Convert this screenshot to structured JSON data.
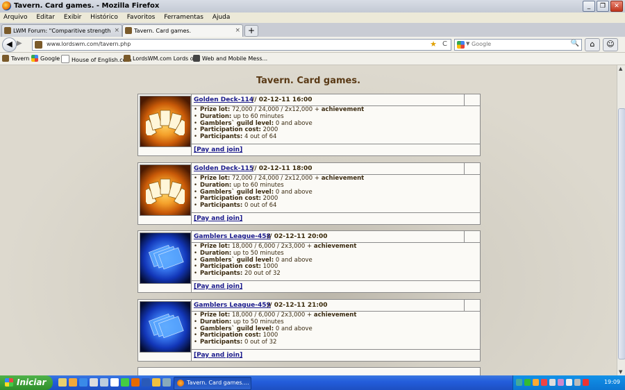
{
  "window": {
    "title": "Tavern. Card games. - Mozilla Firefox",
    "min": "_",
    "max": "❐",
    "close": "✕"
  },
  "menu": [
    "Arquivo",
    "Editar",
    "Exibir",
    "Histórico",
    "Favoritos",
    "Ferramentas",
    "Ajuda"
  ],
  "tabs": [
    {
      "label": "LWM Forum: \"Comparitive strengths\". Lo...",
      "close": "×"
    },
    {
      "label": "Tavern. Card games.",
      "close": "×"
    }
  ],
  "newtab": "+",
  "nav": {
    "back": "◀",
    "forward": "▶",
    "url": "www.lordswm.com/tavern.php",
    "search_placeholder": "Google",
    "star": "★",
    "reload": "C",
    "search_icon": "🔍",
    "home": "⌂",
    "addon": "☺"
  },
  "bookmarks": [
    "Tavern",
    "Google",
    "House of English.com",
    "LordsWM.com Lords o...",
    "Web and Mobile Mess..."
  ],
  "page": {
    "title": "Tavern. Card games.",
    "tournaments": [
      {
        "name": "Golden Deck-114",
        "date": "// 02-12-11 16:00",
        "icon": "golden-cards",
        "prize_label": "Prize lot:",
        "prize": "72,000 / 24,000 / 2x12,000 +",
        "prize_extra": "achievement",
        "duration_label": "Duration:",
        "duration": "up to 60 minutes",
        "guild_label": "Gamblers` guild level:",
        "guild": "0 and above",
        "cost_label": "Participation cost:",
        "cost": "2000",
        "participants_label": "Participants:",
        "participants": "4 out of 64",
        "join": "[Pay and join]"
      },
      {
        "name": "Golden Deck-115",
        "date": "// 02-12-11 18:00",
        "icon": "golden-cards",
        "prize_label": "Prize lot:",
        "prize": "72,000 / 24,000 / 2x12,000 +",
        "prize_extra": "achievement",
        "duration_label": "Duration:",
        "duration": "up to 60 minutes",
        "guild_label": "Gamblers` guild level:",
        "guild": "0 and above",
        "cost_label": "Participation cost:",
        "cost": "2000",
        "participants_label": "Participants:",
        "participants": "0 out of 64",
        "join": "[Pay and join]"
      },
      {
        "name": "Gamblers League-458",
        "date": "// 02-12-11 20:00",
        "icon": "blue-cards",
        "prize_label": "Prize lot:",
        "prize": "18,000 / 6,000 / 2x3,000 +",
        "prize_extra": "achievement",
        "duration_label": "Duration:",
        "duration": "up to 50 minutes",
        "guild_label": "Gamblers` guild level:",
        "guild": "0 and above",
        "cost_label": "Participation cost:",
        "cost": "1000",
        "participants_label": "Participants:",
        "participants": "20 out of 32",
        "join": "[Pay and join]"
      },
      {
        "name": "Gamblers League-459",
        "date": "// 02-12-11 21:00",
        "icon": "blue-cards",
        "prize_label": "Prize lot:",
        "prize": "18,000 / 6,000 / 2x3,000 +",
        "prize_extra": "achievement",
        "duration_label": "Duration:",
        "duration": "up to 50 minutes",
        "guild_label": "Gamblers` guild level:",
        "guild": "0 and above",
        "cost_label": "Participation cost:",
        "cost": "1000",
        "participants_label": "Participants:",
        "participants": "0 out of 32",
        "join": "[Pay and join]"
      }
    ]
  },
  "taskbar": {
    "start": "Iniciar",
    "active_window": "Tavern. Card games....",
    "clock": "19:09"
  },
  "colors": {
    "link": "#1a1a8c",
    "title": "#5a3a16",
    "taskbar": "#245edc",
    "start": "#2f8f2b"
  }
}
